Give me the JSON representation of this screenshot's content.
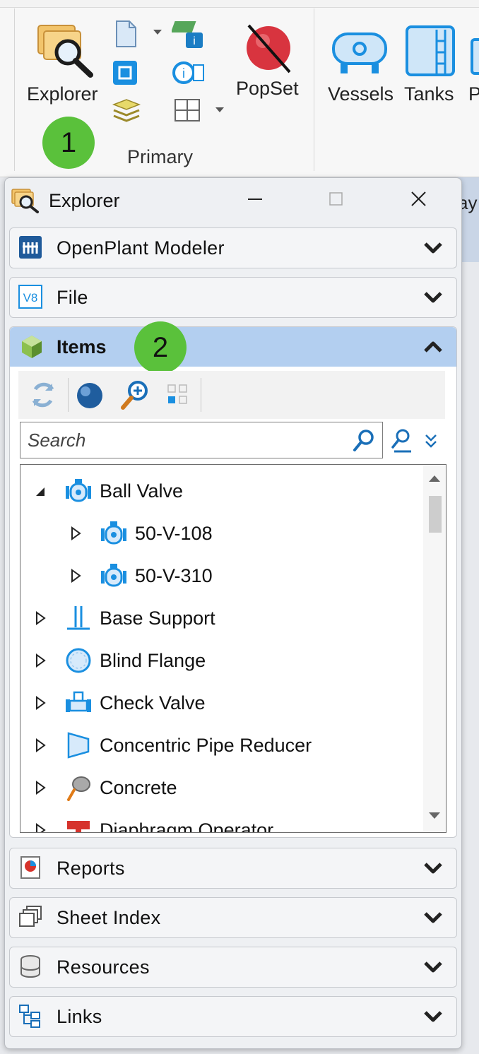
{
  "ribbon": {
    "explorer_label": "Explorer",
    "popset_label": "PopSet",
    "vessels_label": "Vessels",
    "tanks_label": "Tanks",
    "partial_label": "P",
    "group_label": "Primary",
    "badge_1": "1"
  },
  "background": {
    "partial_text": "ay"
  },
  "window": {
    "title": "Explorer",
    "minimize_label": "—",
    "close_label": "✕"
  },
  "sections": {
    "openplant": "OpenPlant Modeler",
    "file": "File",
    "items": "Items",
    "reports": "Reports",
    "sheet_index": "Sheet Index",
    "resources": "Resources",
    "links": "Links"
  },
  "badge_2": "2",
  "search": {
    "placeholder": "Search",
    "value": ""
  },
  "tree": [
    {
      "label": "Ball Valve",
      "expanded": true,
      "icon": "valve-icon"
    },
    {
      "label": "50-V-108",
      "expanded": false,
      "icon": "valve-icon"
    },
    {
      "label": "50-V-310",
      "expanded": false,
      "icon": "valve-icon"
    },
    {
      "label": "Base Support",
      "expanded": false,
      "icon": "base-support-icon"
    },
    {
      "label": "Blind Flange",
      "expanded": false,
      "icon": "blind-flange-icon"
    },
    {
      "label": "Check Valve",
      "expanded": false,
      "icon": "check-valve-icon"
    },
    {
      "label": "Concentric Pipe Reducer",
      "expanded": false,
      "icon": "pipe-reducer-icon"
    },
    {
      "label": "Concrete",
      "expanded": false,
      "icon": "concrete-icon"
    },
    {
      "label": "Diaphragm Operator",
      "expanded": false,
      "icon": "diaphragm-operator-icon"
    }
  ],
  "colors": {
    "accent": "#b3cff0",
    "badge": "#5ac13b",
    "icon_blue": "#1a8fe0"
  }
}
